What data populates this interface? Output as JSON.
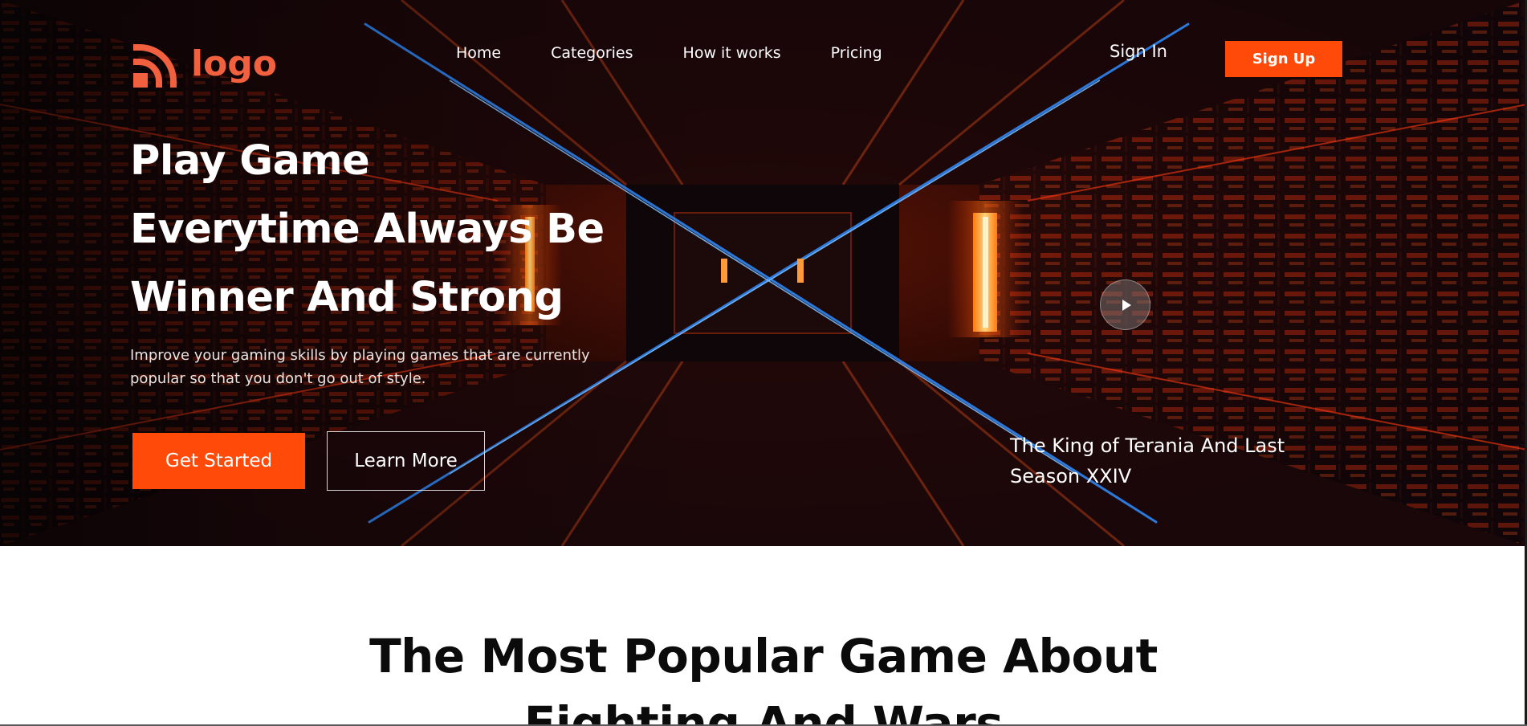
{
  "header": {
    "logo_text": "logo",
    "nav": [
      {
        "label": "Home"
      },
      {
        "label": "Categories"
      },
      {
        "label": "How it works"
      },
      {
        "label": "Pricing"
      }
    ],
    "sign_in": "Sign In",
    "sign_up": "Sign Up"
  },
  "hero": {
    "headline_lines": [
      "Play Game",
      "Everytime Always Be",
      "Winner And Strong"
    ],
    "subtext": "Improve your gaming skills by playing games that are currently popular so that you don't go out of style.",
    "primary_button": "Get Started",
    "secondary_button": "Learn More",
    "featured_title_lines": [
      "The King of Terania And Last",
      "Season XXIV"
    ],
    "play_icon": "play-icon"
  },
  "section": {
    "title_lines": [
      "The Most Popular Game About",
      "Fighting And Wars"
    ]
  },
  "colors": {
    "accent": "#ff4a0a",
    "logo": "#f1603f",
    "hero_dark": "#080304",
    "neon_orange": "#ff6a1a",
    "neon_blue": "#2f8dff"
  }
}
